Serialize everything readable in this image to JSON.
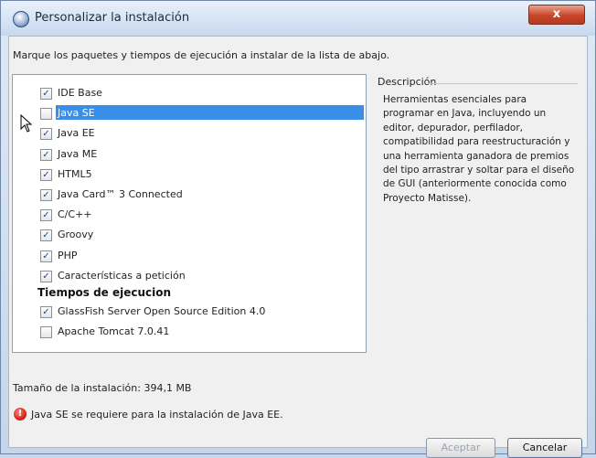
{
  "window": {
    "title": "Personalizar la instalación",
    "close_label": "x"
  },
  "instructions": "Marque los paquetes y tiempos de ejecución a instalar de la lista de abajo.",
  "packages": [
    {
      "label": "IDE Base",
      "checked": true
    },
    {
      "label": "Java SE",
      "checked": false,
      "selected": true
    },
    {
      "label": "Java EE",
      "checked": true
    },
    {
      "label": "Java ME",
      "checked": true
    },
    {
      "label": "HTML5",
      "checked": true
    },
    {
      "label": "Java Card™ 3 Connected",
      "checked": true
    },
    {
      "label": "C/C++",
      "checked": true
    },
    {
      "label": "Groovy",
      "checked": true
    },
    {
      "label": "PHP",
      "checked": true
    },
    {
      "label": "Características a petición",
      "checked": true
    }
  ],
  "runtimes_header": "Tiempos de ejecucion",
  "runtimes": [
    {
      "label": "GlassFish Server Open Source Edition 4.0",
      "checked": true
    },
    {
      "label": "Apache Tomcat 7.0.41",
      "checked": false
    }
  ],
  "description": {
    "title": "Descripción",
    "text": "Herramientas esenciales para programar en Java, incluyendo un editor, depurador, perfilador, compatibilidad para reestructuración y una herramienta ganadora de premios del tipo arrastrar y soltar para el diseño de GUI (anteriormente conocida como Proyecto Matisse)."
  },
  "install_size": "Tamaño de la instalación: 394,1 MB",
  "error_message": "Java SE se requiere para la instalación de Java EE.",
  "buttons": {
    "accept": "Aceptar",
    "cancel": "Cancelar"
  },
  "colors": {
    "selection": "#3b8ee8",
    "error": "#d7261b"
  }
}
